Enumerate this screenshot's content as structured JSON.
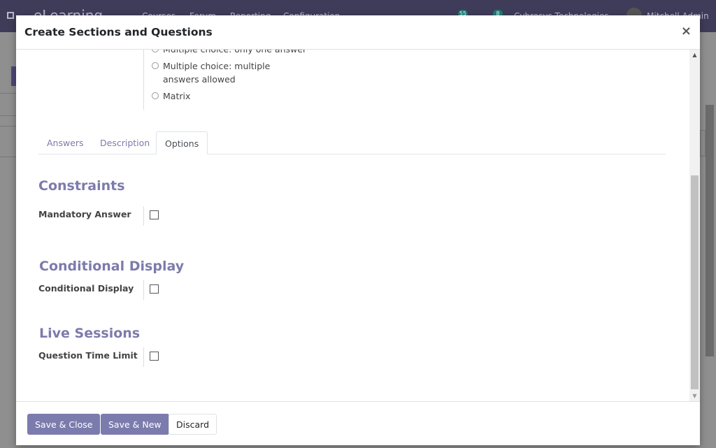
{
  "background": {
    "brand": "eLearning",
    "menu": [
      "Courses",
      "Forum",
      "Reporting",
      "Configuration"
    ],
    "badge_activity": "55",
    "badge_messages": "8",
    "company": "Cybrosys Technologies",
    "user": "Mitchell Admin"
  },
  "modal": {
    "title": "Create Sections and Questions",
    "close_label": "×"
  },
  "question_types": [
    {
      "label": "Multiple choice: only one answer"
    },
    {
      "label": "Multiple choice: multiple answers allowed"
    },
    {
      "label": "Matrix"
    }
  ],
  "tabs": [
    {
      "label": "Answers",
      "active": false
    },
    {
      "label": "Description",
      "active": false
    },
    {
      "label": "Options",
      "active": true
    }
  ],
  "sections": {
    "constraints": {
      "title": "Constraints",
      "field_label": "Mandatory Answer",
      "checked": false
    },
    "conditional": {
      "title": "Conditional Display",
      "field_label": "Conditional Display",
      "checked": false
    },
    "live": {
      "title": "Live Sessions",
      "field_label": "Question Time Limit",
      "checked": false
    }
  },
  "footer": {
    "save_close": "Save & Close",
    "save_new": "Save & New",
    "discard": "Discard"
  },
  "colors": {
    "accent": "#7c7bad",
    "navbar": "#3f3c59"
  }
}
